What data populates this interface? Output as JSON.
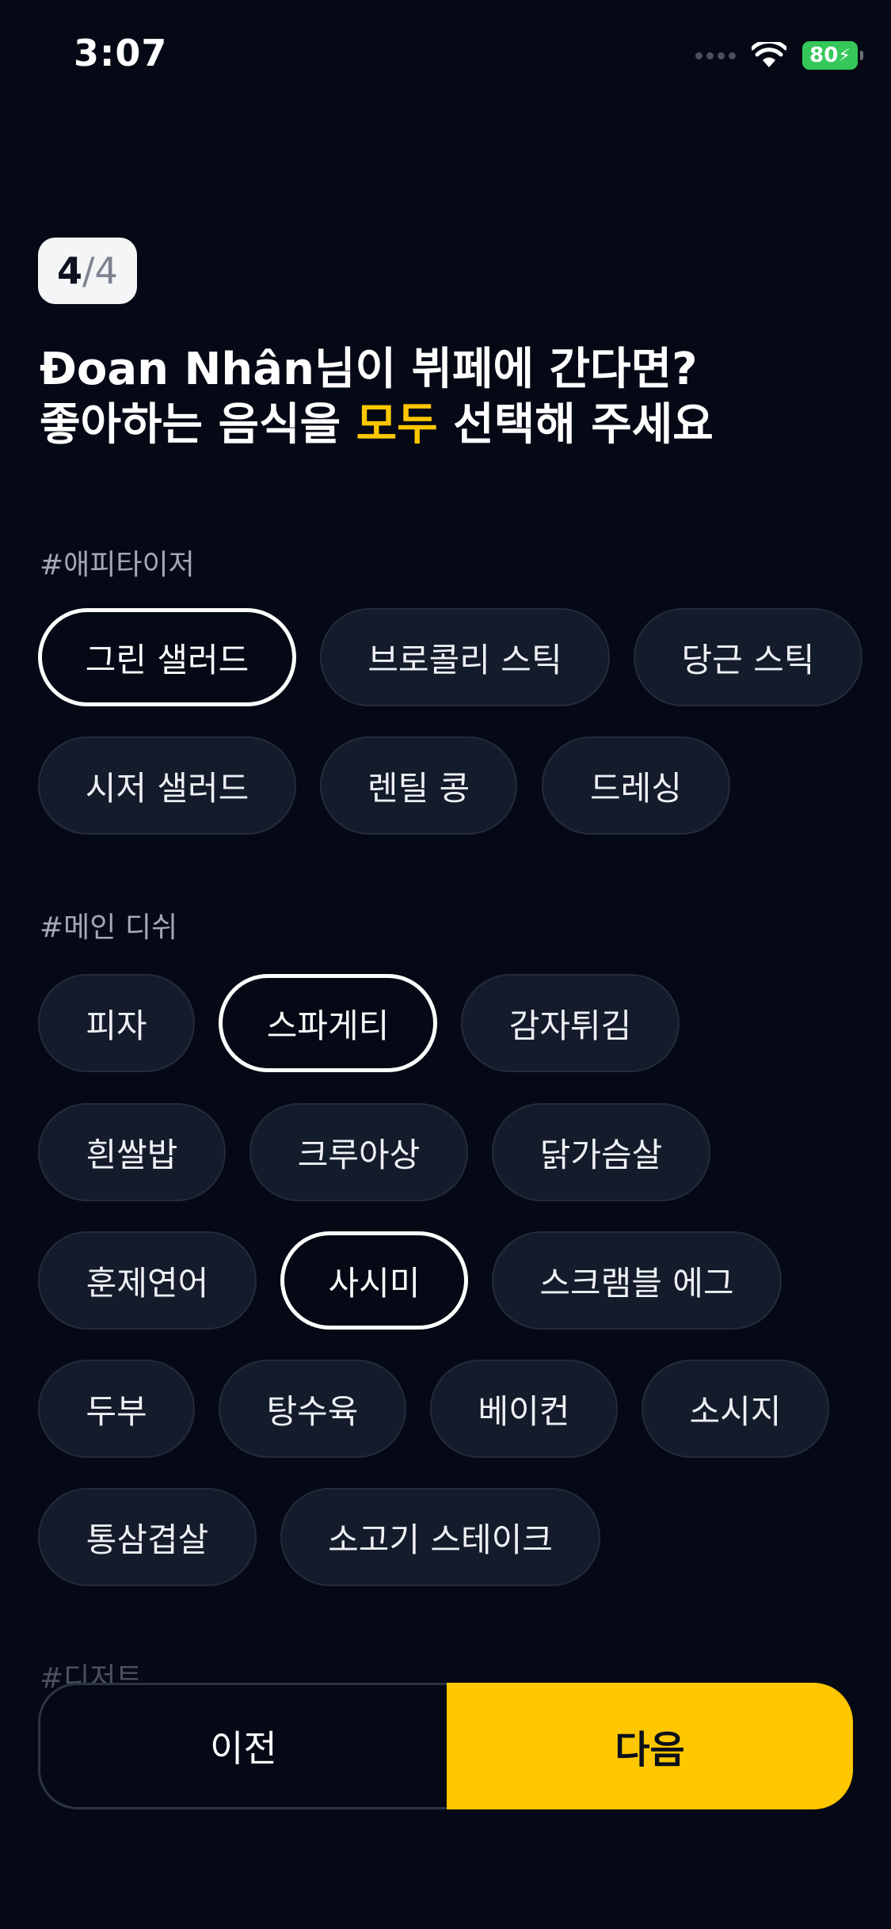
{
  "status_bar": {
    "time": "3:07",
    "battery": "80",
    "icons": [
      "signal-icon",
      "wifi-icon",
      "battery-charging-icon"
    ]
  },
  "step": {
    "current": "4",
    "separator": "/",
    "total": "4"
  },
  "title": {
    "line1": "Đoan Nhân님이 뷔페에 간다면?",
    "line2_pre": "좋아하는 음식을 ",
    "line2_highlight": "모두",
    "line2_post": " 선택해 주세요"
  },
  "colors": {
    "accent": "#ffc700",
    "background": "#050915",
    "chip": "#141b2b"
  },
  "sections": {
    "appetizer": {
      "label": "#애피타이저",
      "items": [
        {
          "label": "그린 샐러드",
          "selected": true
        },
        {
          "label": "브로콜리 스틱",
          "selected": false
        },
        {
          "label": "당근 스틱",
          "selected": false
        },
        {
          "label": "시저 샐러드",
          "selected": false
        },
        {
          "label": "렌틸 콩",
          "selected": false
        },
        {
          "label": "드레싱",
          "selected": false
        }
      ]
    },
    "main": {
      "label": "#메인 디쉬",
      "items": [
        {
          "label": "피자",
          "selected": false
        },
        {
          "label": "스파게티",
          "selected": true
        },
        {
          "label": "감자튀김",
          "selected": false
        },
        {
          "label": "흰쌀밥",
          "selected": false
        },
        {
          "label": "크루아상",
          "selected": false
        },
        {
          "label": "닭가슴살",
          "selected": false
        },
        {
          "label": "훈제연어",
          "selected": false
        },
        {
          "label": "사시미",
          "selected": true
        },
        {
          "label": "스크램블 에그",
          "selected": false
        },
        {
          "label": "두부",
          "selected": false
        },
        {
          "label": "탕수육",
          "selected": false
        },
        {
          "label": "베이컨",
          "selected": false
        },
        {
          "label": "소시지",
          "selected": false
        },
        {
          "label": "통삼겹살",
          "selected": false
        },
        {
          "label": "소고기 스테이크",
          "selected": false
        }
      ]
    },
    "dessert": {
      "label": "#디저트"
    }
  },
  "footer": {
    "prev_label": "이전",
    "next_label": "다음"
  }
}
